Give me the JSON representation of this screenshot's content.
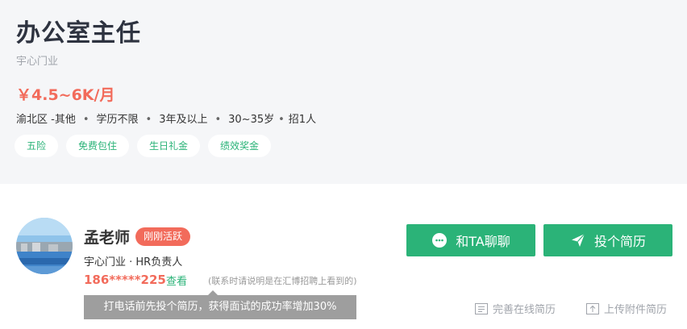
{
  "job": {
    "title": "办公室主任",
    "company": "宇心门业",
    "salary": "￥4.5~6K/月",
    "requirements": [
      "渝北区 -其他",
      "学历不限",
      "3年及以上",
      "30~35岁",
      "招1人"
    ],
    "tags": [
      "五险",
      "免费包住",
      "生日礼金",
      "绩效奖金"
    ]
  },
  "recruiter": {
    "name": "孟老师",
    "status_badge": "刚刚活跃",
    "role": "宇心门业 · HR负责人",
    "phone": "186*****225",
    "view_label": "查看",
    "contact_note": "(联系时请说明是在汇博招聘上看到的)",
    "tooltip": "打电话前先投个简历，获得面试的成功率增加30%"
  },
  "actions": {
    "chat_label": "和TA聊聊",
    "apply_label": "投个简历",
    "complete_resume_label": "完善在线简历",
    "upload_resume_label": "上传附件简历"
  },
  "icons": {
    "chat": "chat-bubble-icon",
    "apply": "paper-plane-icon",
    "resume": "document-list-icon",
    "upload": "upload-icon"
  },
  "colors": {
    "accent_green": "#2bb378",
    "salary_red": "#f26b5b",
    "header_bg": "#f5f6f8"
  }
}
